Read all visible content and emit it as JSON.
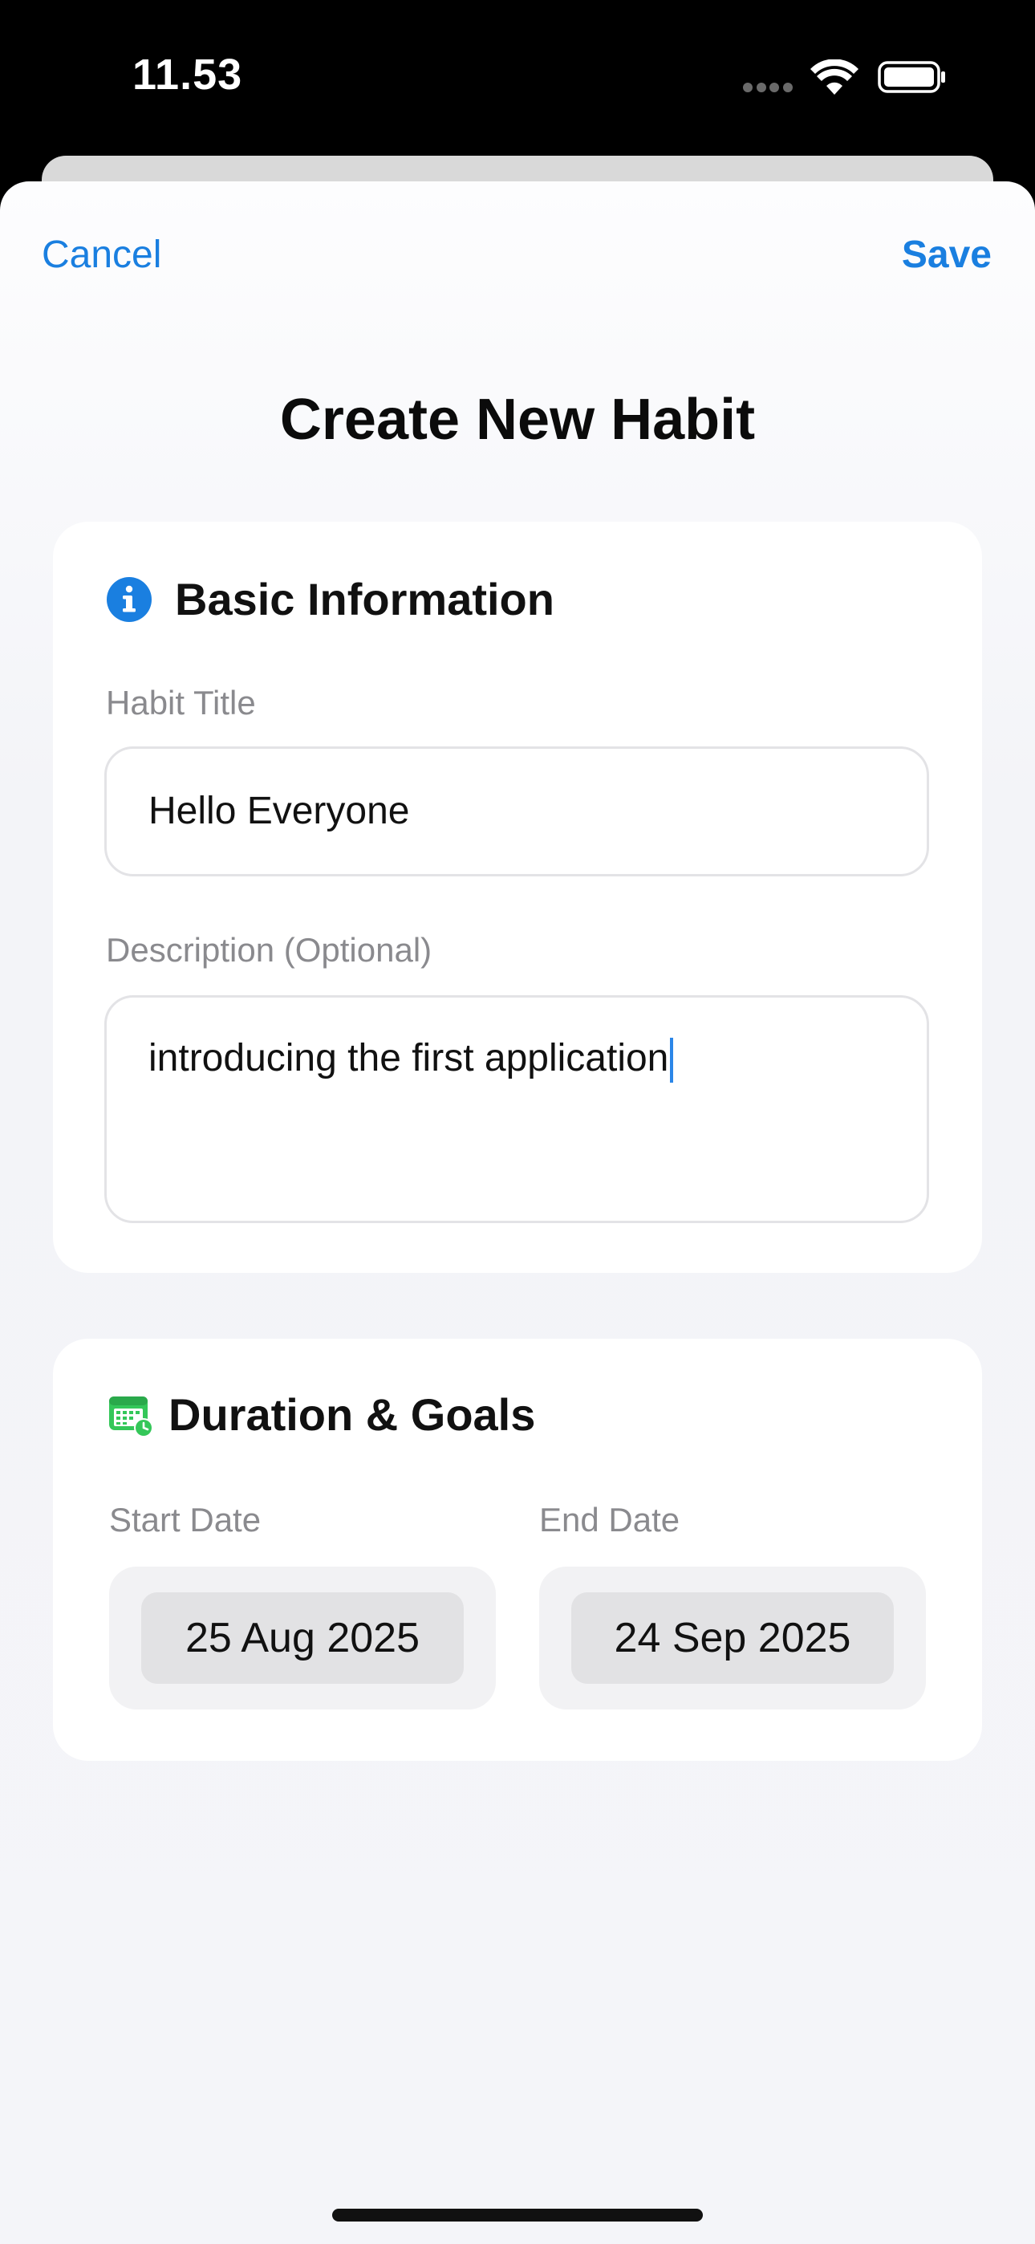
{
  "status_bar": {
    "time": "11.53",
    "icons": [
      "cellular-dots-icon",
      "wifi-icon",
      "battery-icon"
    ]
  },
  "nav": {
    "cancel_label": "Cancel",
    "save_label": "Save"
  },
  "page": {
    "title": "Create New Habit"
  },
  "basic_info": {
    "icon": "info-circle-icon",
    "title": "Basic Information",
    "habit_title_label": "Habit Title",
    "habit_title_value": "Hello Everyone",
    "description_label": "Description (Optional)",
    "description_value": "introducing the first application"
  },
  "duration": {
    "icon": "calendar-clock-icon",
    "title": "Duration & Goals",
    "start_label": "Start Date",
    "start_value": "25 Aug 2025",
    "end_label": "End Date",
    "end_value": "24 Sep 2025"
  },
  "colors": {
    "accent": "#1a7fe0",
    "calendar_icon": "#34c759",
    "background": "#f4f5f9"
  }
}
